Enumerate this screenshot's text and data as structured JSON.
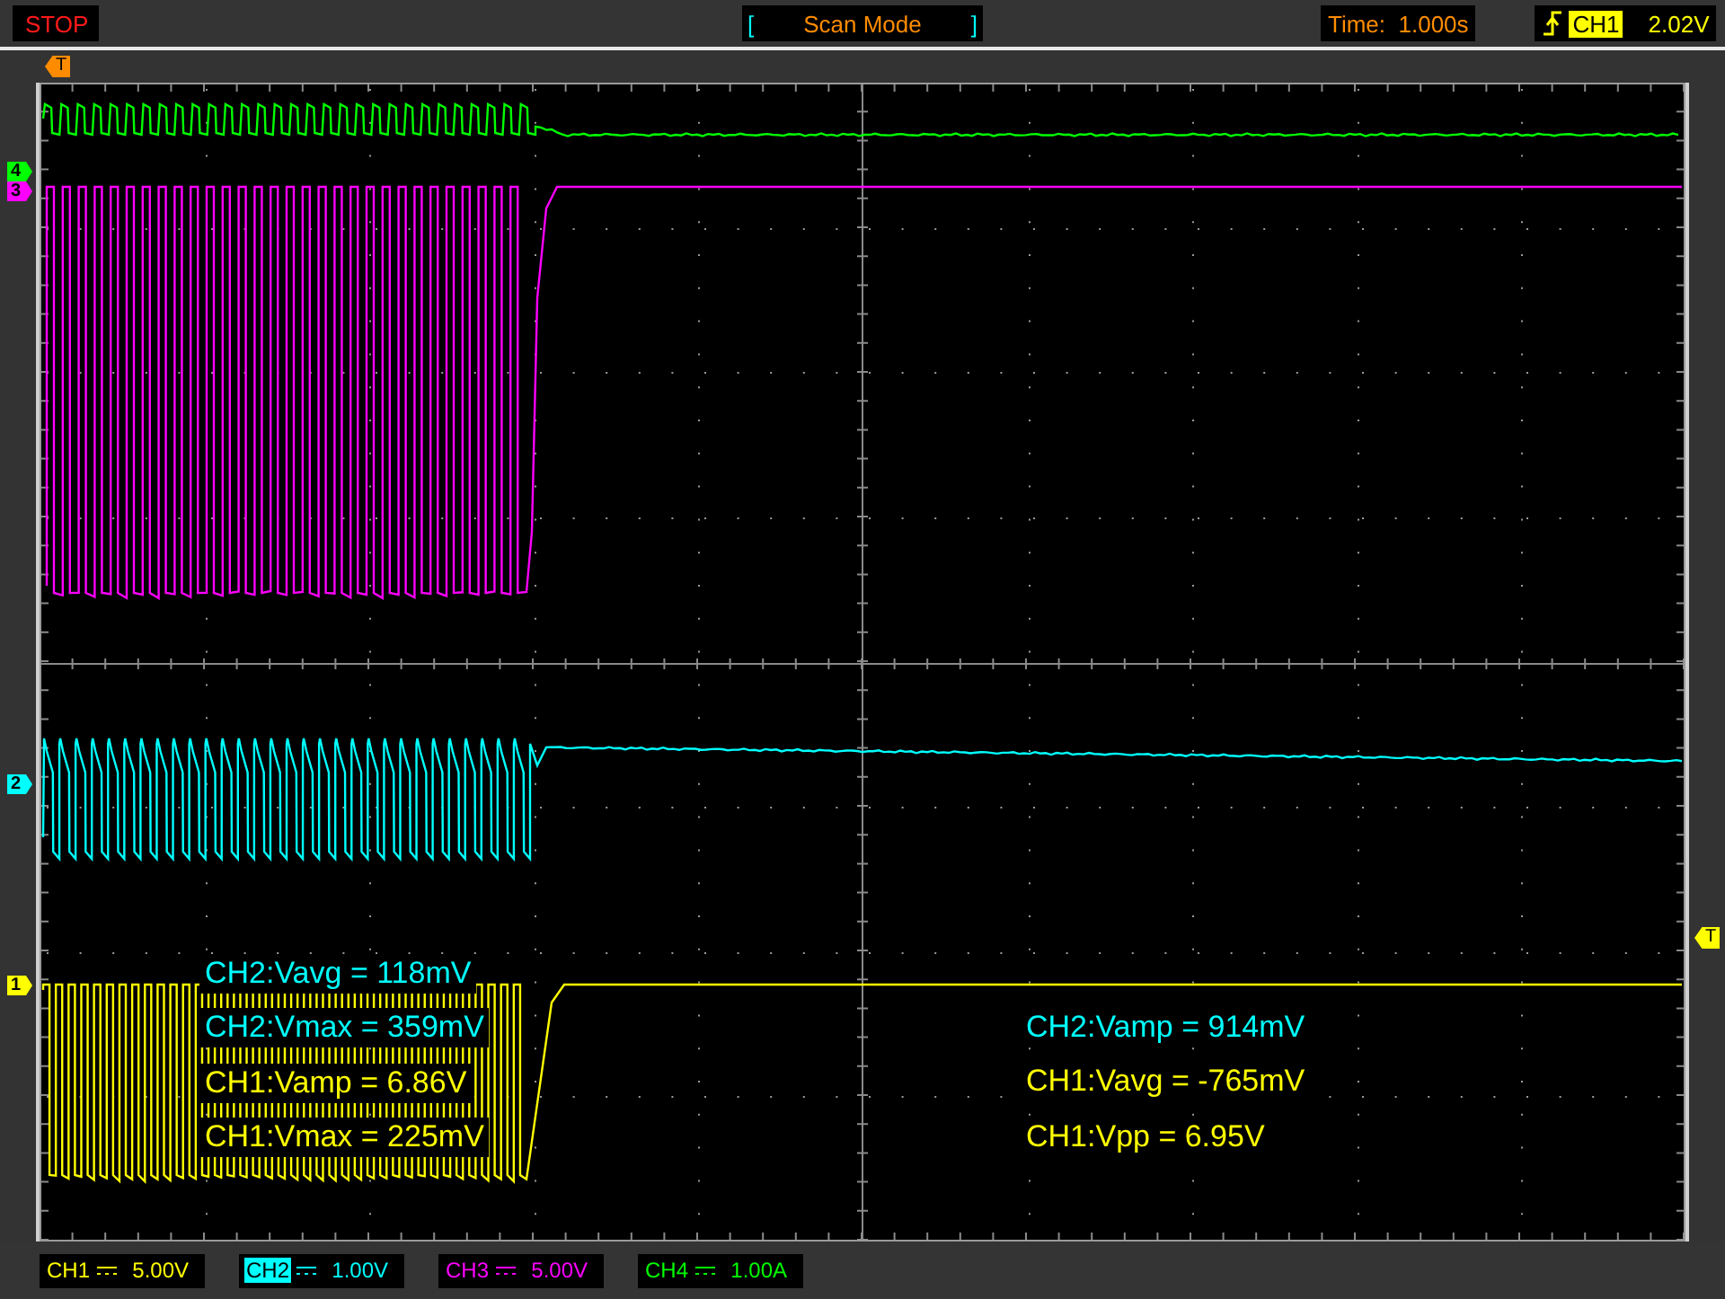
{
  "top_bar": {
    "status": "STOP",
    "mode": {
      "open": "[",
      "label": "Scan Mode",
      "close": "]"
    },
    "time": "Time:  1.000s",
    "trigger": {
      "source": "CH1",
      "level": "2.02V"
    }
  },
  "time_marker": {
    "label": "T"
  },
  "level_marker": {
    "label": "T"
  },
  "channel_markers": [
    {
      "label": "4",
      "color": "#00ff00"
    },
    {
      "label": "3",
      "color": "#ff00ff"
    },
    {
      "label": "2",
      "color": "#00ffff"
    },
    {
      "label": "1",
      "color": "#ffff00"
    }
  ],
  "measurements_left": [
    {
      "text": "CH2:Vavg = 118mV",
      "color": "#00ffff"
    },
    {
      "text": "CH2:Vmax = 359mV",
      "color": "#00ffff"
    },
    {
      "text": "CH1:Vamp = 6.86V",
      "color": "#ffff00"
    },
    {
      "text": "CH1:Vmax = 225mV",
      "color": "#ffff00"
    }
  ],
  "measurements_right": [
    {
      "text": "CH2:Vamp = 914mV",
      "color": "#00ffff"
    },
    {
      "text": "CH1:Vavg = -765mV",
      "color": "#ffff00"
    },
    {
      "text": "CH1:Vpp = 6.95V",
      "color": "#ffff00"
    }
  ],
  "channels": [
    {
      "name": "CH1",
      "scale": "5.00V",
      "color": "#ffff00",
      "selected": false
    },
    {
      "name": "CH2",
      "scale": "1.00V",
      "color": "#00ffff",
      "selected": true
    },
    {
      "name": "CH3",
      "scale": "5.00V",
      "color": "#ff00ff",
      "selected": false
    },
    {
      "name": "CH4",
      "scale": "1.00A",
      "color": "#00ff00",
      "selected": false
    }
  ]
}
